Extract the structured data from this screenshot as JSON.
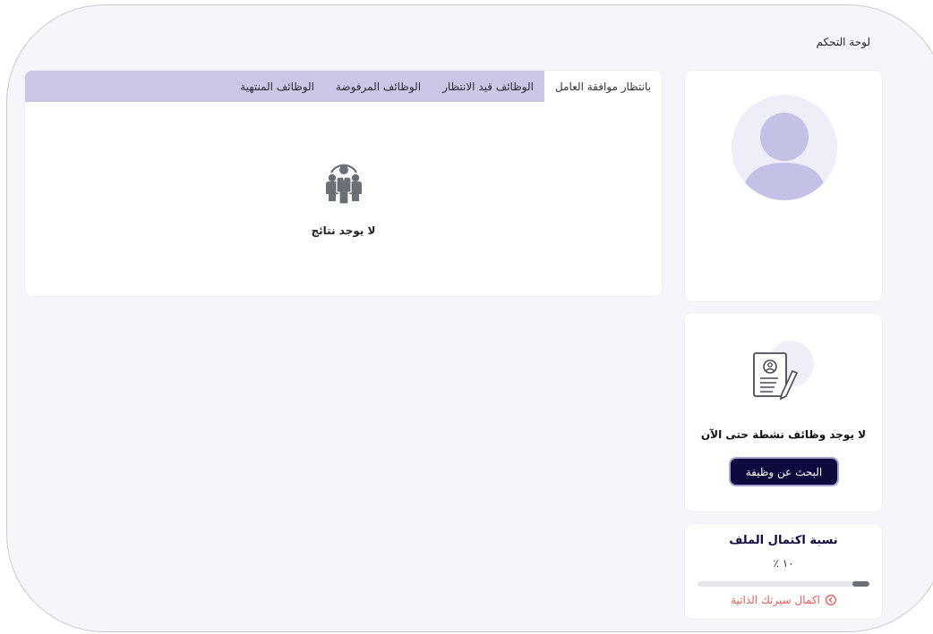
{
  "header": {
    "title": "لوحة التحكم"
  },
  "jobs": {
    "tabs": [
      {
        "label": "بانتظار موافقة العامل",
        "active": true
      },
      {
        "label": "الوظائف قيد الانتظار",
        "active": false
      },
      {
        "label": "الوظائف المرفوضة",
        "active": false
      },
      {
        "label": "الوظائف المنتهية",
        "active": false
      }
    ],
    "empty_icon": "team-icon",
    "empty_text": "لا يوجد نتائج"
  },
  "profile": {
    "avatar_icon": "user-avatar-icon"
  },
  "active_jobs": {
    "icon": "resume-icon",
    "empty_text": "لا يوجد وظائف نشطة حتى الآن",
    "search_button": "البحث عن وظيفة"
  },
  "completion": {
    "title": "نسبة اكتمال الملف",
    "percent_text": "٪ ١٠",
    "progress": 0.1,
    "link_text": "اكمال سيرتك الذاتية",
    "link_icon": "arrow-circle-icon"
  },
  "colors": {
    "accent": "#0d0b3d",
    "tab_bar": "#c9c6e6",
    "link": "#e25b5b",
    "avatar": "#c4c1e6"
  }
}
